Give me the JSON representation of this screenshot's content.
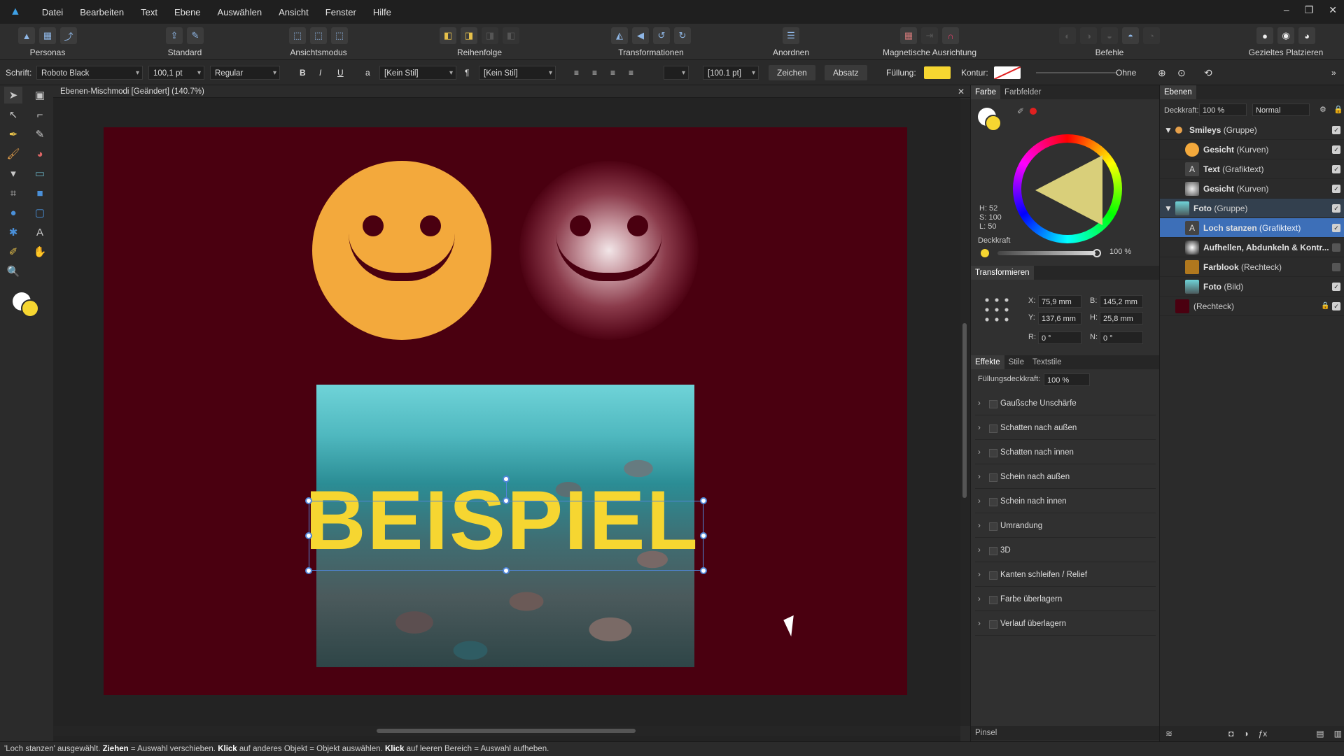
{
  "menu": [
    "Datei",
    "Bearbeiten",
    "Text",
    "Ebene",
    "Auswählen",
    "Ansicht",
    "Fenster",
    "Hilfe"
  ],
  "toolbar": {
    "groups": [
      "Personas",
      "Standard",
      "Ansichtsmodus",
      "Reihenfolge",
      "Transformationen",
      "Anordnen",
      "Magnetische Ausrichtung",
      "Befehle",
      "Gezieltes Platzieren"
    ]
  },
  "ctx": {
    "schrift_label": "Schrift:",
    "font": "Roboto Black",
    "size": "100,1 pt",
    "style": "Regular",
    "bold": "B",
    "italic": "I",
    "underline": "U",
    "char_style": "[Kein Stil]",
    "para_style": "[Kein Stil]",
    "leading": "[100.1 pt]",
    "zeichen": "Zeichen",
    "absatz": "Absatz",
    "fuellung_label": "Füllung:",
    "kontur_label": "Kontur:",
    "ohne": "Ohne",
    "colors": {
      "fill": "#f6d631"
    }
  },
  "doc": {
    "title": "Ebenen-Mischmodi [Geändert] (140.7%)",
    "text": "BEISPIEL"
  },
  "farbe": {
    "tabs": [
      "Farbe",
      "Farbfelder"
    ],
    "h": "H: 52",
    "s": "S: 100",
    "l": "L: 50",
    "deckkraft_label": "Deckkraft",
    "deckkraft": "100 %"
  },
  "transform": {
    "title": "Transformieren",
    "x_label": "X:",
    "x": "75,9 mm",
    "y_label": "Y:",
    "y": "137,6 mm",
    "b_label": "B:",
    "b": "145,2 mm",
    "h_label": "H:",
    "h": "25,8 mm",
    "r_label": "R:",
    "r": "0 °",
    "n_label": "N:",
    "n": "0 °"
  },
  "effects": {
    "tabs": [
      "Effekte",
      "Stile",
      "Textstile"
    ],
    "fill_label": "Füllungsdeckkraft:",
    "fill": "100 %",
    "items": [
      "Gaußsche Unschärfe",
      "Schatten nach außen",
      "Schatten nach innen",
      "Schein nach außen",
      "Schein nach innen",
      "Umrandung",
      "3D",
      "Kanten schleifen / Relief",
      "Farbe überlagern",
      "Verlauf überlagern"
    ]
  },
  "pinsel": "Pinsel",
  "layers": {
    "tab": "Ebenen",
    "deck_label": "Deckkraft:",
    "deck": "100 %",
    "mode": "Normal",
    "rows": [
      {
        "name": "Smileys",
        "type": "(Gruppe)"
      },
      {
        "name": "Gesicht",
        "type": "(Kurven)"
      },
      {
        "name": "Text",
        "type": "(Grafiktext)"
      },
      {
        "name": "Gesicht",
        "type": "(Kurven)"
      },
      {
        "name": "Foto",
        "type": "(Gruppe)"
      },
      {
        "name": "Loch stanzen",
        "type": "(Grafiktext)"
      },
      {
        "name": "Aufhellen, Abdunkeln & Kontr...",
        "type": ""
      },
      {
        "name": "Farblook",
        "type": "(Rechteck)"
      },
      {
        "name": "Foto",
        "type": "(Bild)"
      },
      {
        "name": "",
        "type": "(Rechteck)"
      }
    ]
  },
  "status": {
    "p1": "'Loch stanzen' ausgewählt. ",
    "b1": "Ziehen",
    "p2": " = Auswahl verschieben. ",
    "b2": "Klick",
    "p3": " auf anderes Objekt = Objekt auswählen. ",
    "b3": "Klick",
    "p4": " auf leeren Bereich = Auswahl aufheben."
  }
}
